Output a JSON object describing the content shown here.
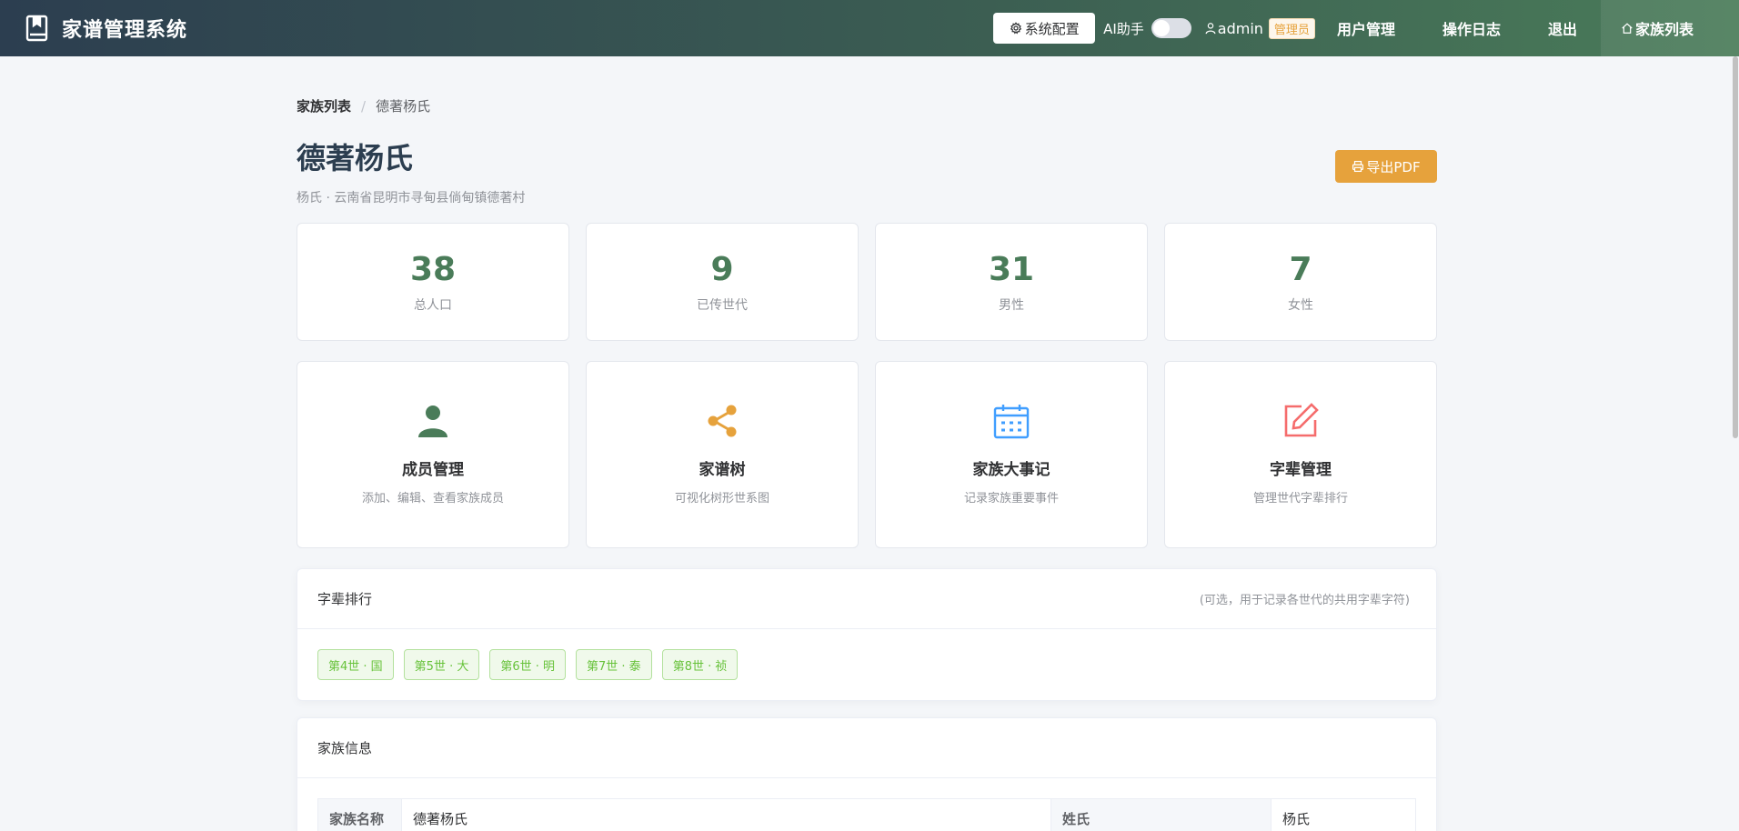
{
  "app": {
    "title": "家谱管理系统"
  },
  "nav": {
    "config_label": "系统配置",
    "ai_label": "AI助手",
    "ai_enabled": false,
    "user_name": "admin",
    "role_badge": "管理员",
    "links": [
      "用户管理",
      "操作日志",
      "退出"
    ],
    "home_label": "家族列表"
  },
  "breadcrumb": {
    "parent": "家族列表",
    "current": "德著杨氏"
  },
  "family": {
    "name": "德著杨氏",
    "subtitle": "杨氏 · 云南省昆明市寻甸县倘甸镇德著村",
    "export_label": "导出PDF"
  },
  "stats": [
    {
      "value": "38",
      "label": "总人口"
    },
    {
      "value": "9",
      "label": "已传世代"
    },
    {
      "value": "31",
      "label": "男性"
    },
    {
      "value": "7",
      "label": "女性"
    }
  ],
  "features": [
    {
      "icon": "user-icon",
      "color": "#4a7c59",
      "title": "成员管理",
      "desc": "添加、编辑、查看家族成员"
    },
    {
      "icon": "share-icon",
      "color": "#e6a23c",
      "title": "家谱树",
      "desc": "可视化树形世系图"
    },
    {
      "icon": "calendar-icon",
      "color": "#409eff",
      "title": "家族大事记",
      "desc": "记录家族重要事件"
    },
    {
      "icon": "edit-icon",
      "color": "#f56c6c",
      "title": "字辈管理",
      "desc": "管理世代字辈排行"
    }
  ],
  "generations": {
    "title": "字辈排行",
    "hint": "(可选，用于记录各世代的共用字辈字符)",
    "tags": [
      "第4世 · 国",
      "第5世 · 大",
      "第6世 · 明",
      "第7世 · 泰",
      "第8世 · 祯"
    ]
  },
  "info": {
    "title": "家族信息",
    "rows": [
      {
        "k1": "家族名称",
        "v1": "德著杨氏",
        "k2": "姓氏",
        "v2": "杨氏"
      }
    ]
  },
  "colors": {
    "primary": "#4a7c59",
    "header_start": "#2c3e50",
    "accent": "#e6a23c"
  }
}
